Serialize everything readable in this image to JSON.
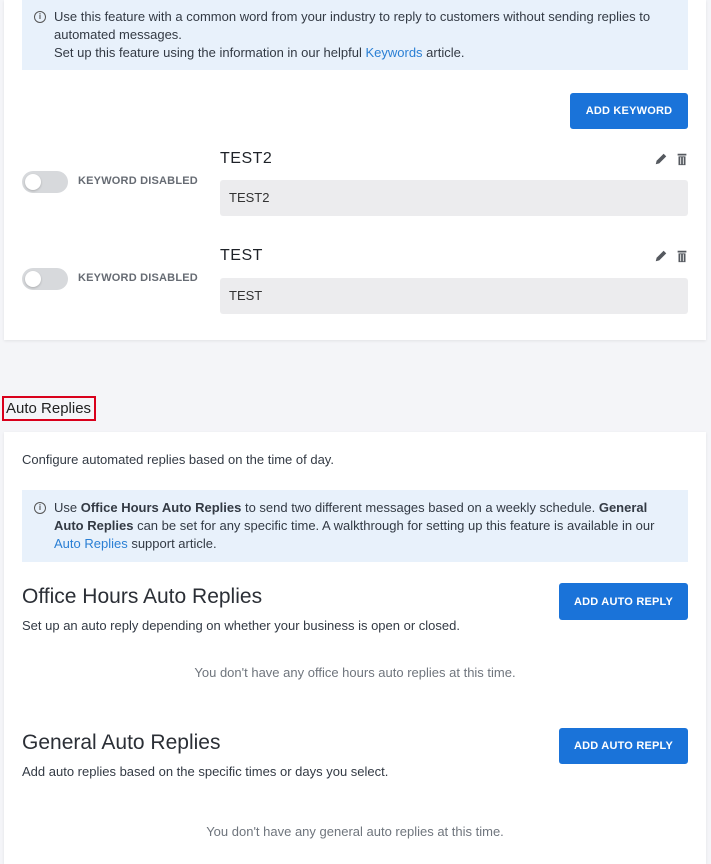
{
  "keywords_section": {
    "info_line1": "Use this feature with a common word from your industry to reply to customers without sending replies to automated messages.",
    "info_line2_prefix": "Set up this feature using the information in our helpful ",
    "info_link": "Keywords",
    "info_line2_suffix": " article.",
    "add_button": "ADD KEYWORD",
    "items": [
      {
        "toggle_label": "KEYWORD DISABLED",
        "title": "TEST2",
        "value": "TEST2"
      },
      {
        "toggle_label": "KEYWORD DISABLED",
        "title": "TEST",
        "value": "TEST"
      }
    ]
  },
  "auto_replies": {
    "section_title": "Auto Replies",
    "description": "Configure automated replies based on the time of day.",
    "info": {
      "p1": "Use ",
      "b1": "Office Hours Auto Replies",
      "p2": " to send two different messages based on a weekly schedule. ",
      "b2": "General Auto Replies",
      "p3": " can be set for any specific time. A walkthrough for setting up this feature is available in our ",
      "link": "Auto Replies",
      "p4": " support article."
    },
    "office_hours": {
      "title": "Office Hours Auto Replies",
      "subtitle": "Set up an auto reply depending on whether your business is open or closed.",
      "button": "ADD AUTO REPLY",
      "empty": "You don't have any office hours auto replies at this time."
    },
    "general": {
      "title": "General Auto Replies",
      "subtitle": "Add auto replies based on the specific times or days you select.",
      "button": "ADD AUTO REPLY",
      "empty": "You don't have any general auto replies at this time."
    }
  },
  "colors": {
    "primary": "#1a73d9",
    "info_bg": "#e8f1fb",
    "link": "#2a7fd4",
    "highlight": "#d9001b"
  },
  "icons": [
    "info-icon",
    "pencil-icon",
    "trash-icon"
  ]
}
